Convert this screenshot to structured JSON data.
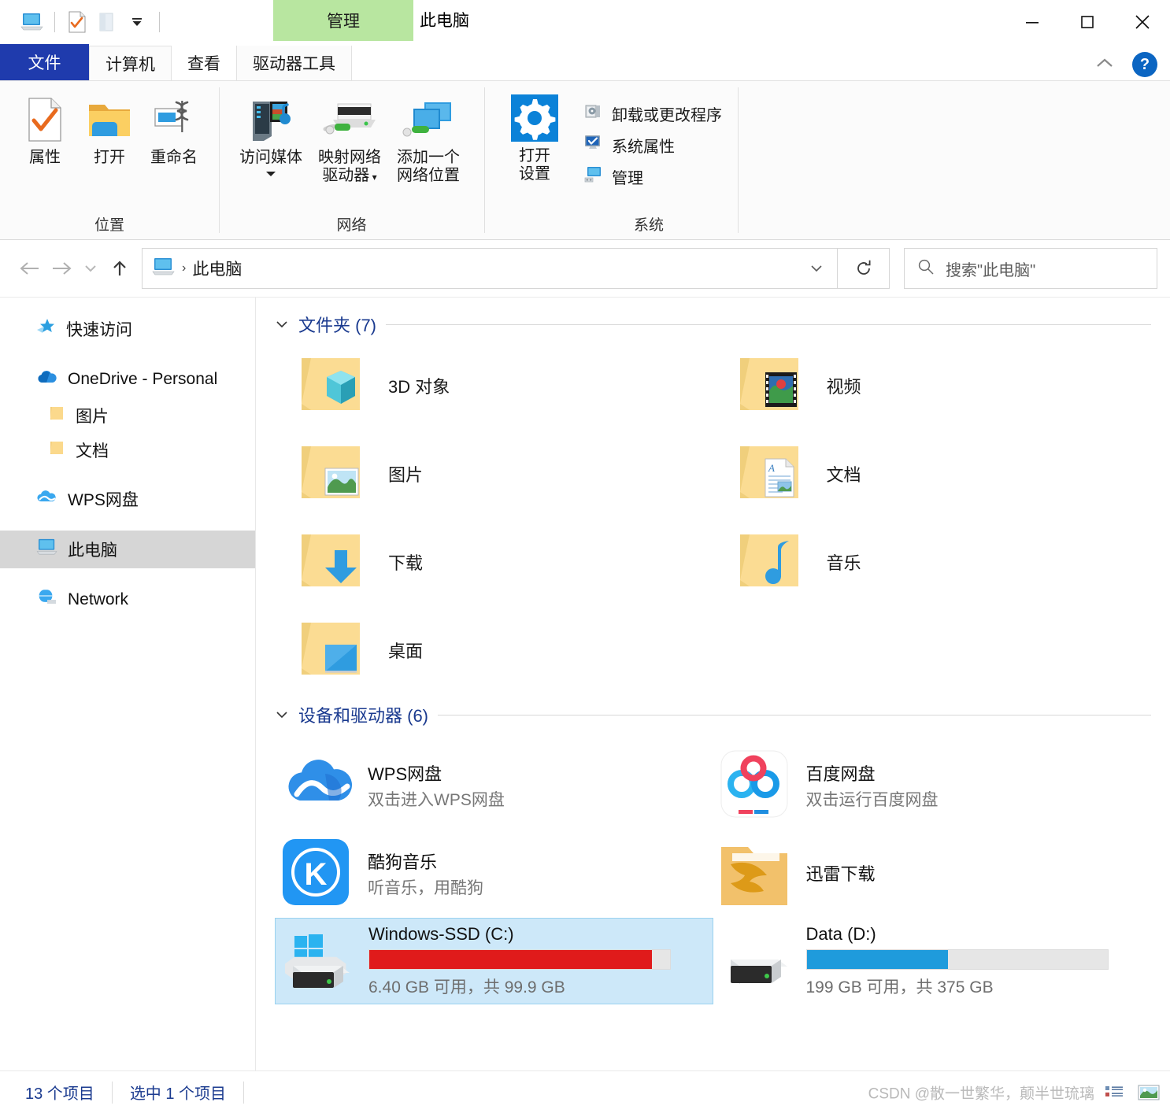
{
  "window": {
    "title": "此电脑",
    "contextual_tab_group": "管理",
    "quick_access_icons": [
      "this-pc-icon",
      "properties-check-icon",
      "open-folder-icon",
      "customize-dropdown-icon"
    ],
    "controls": {
      "minimize": "minimize-icon",
      "maximize": "maximize-icon",
      "close": "close-icon"
    }
  },
  "tabs": [
    {
      "label": "文件",
      "name": "tab-file"
    },
    {
      "label": "计算机",
      "name": "tab-computer"
    },
    {
      "label": "查看",
      "name": "tab-view"
    },
    {
      "label": "驱动器工具",
      "name": "tab-drive-tools"
    }
  ],
  "ribbon": {
    "collapse_icon": "chevron-up-icon",
    "help_label": "?",
    "groups": [
      {
        "label": "位置",
        "name": "ribbon-group-location",
        "buttons": [
          {
            "label": "属性",
            "name": "properties-button",
            "icon": "document-check-icon"
          },
          {
            "label": "打开",
            "name": "open-button",
            "icon": "folder-open-icon"
          },
          {
            "label": "重命名",
            "name": "rename-button",
            "icon": "rename-cursor-icon"
          }
        ]
      },
      {
        "label": "网络",
        "name": "ribbon-group-network",
        "buttons": [
          {
            "label": "访问媒体",
            "name": "access-media-button",
            "icon": "media-server-icon",
            "dropdown": true
          },
          {
            "label_line1": "映射网络",
            "label_line2": "驱动器",
            "name": "map-network-drive-button",
            "icon": "network-drive-icon",
            "dropdown": true
          },
          {
            "label_line1": "添加一个",
            "label_line2": "网络位置",
            "name": "add-network-location-button",
            "icon": "add-network-location-icon"
          }
        ]
      },
      {
        "label": "系统",
        "name": "ribbon-group-system",
        "big_button": {
          "label_line1": "打开",
          "label_line2": "设置",
          "name": "open-settings-button",
          "icon": "gear-icon"
        },
        "items": [
          {
            "label": "卸载或更改程序",
            "name": "uninstall-change-program-item",
            "icon": "uninstall-icon"
          },
          {
            "label": "系统属性",
            "name": "system-properties-item",
            "icon": "system-properties-icon"
          },
          {
            "label": "管理",
            "name": "manage-item",
            "icon": "manage-icon"
          }
        ]
      }
    ]
  },
  "addressbar": {
    "back": "back-arrow-icon",
    "forward": "forward-arrow-icon",
    "recent": "recent-locations-icon",
    "up": "up-arrow-icon",
    "breadcrumb_icon": "this-pc-icon",
    "breadcrumb": "此电脑",
    "breadcrumb_separator": "›",
    "dropdown": "chevron-down-icon",
    "refresh": "refresh-icon",
    "search_placeholder": "搜索\"此电脑\"",
    "search_value": "",
    "search_icon": "search-icon"
  },
  "sidebar": {
    "items": [
      {
        "label": "快速访问",
        "name": "sidebar-item-quick-access",
        "icon": "pin-star-icon",
        "indent": 0,
        "selected": false,
        "gap_after": true
      },
      {
        "label": "OneDrive - Personal",
        "name": "sidebar-item-onedrive",
        "icon": "onedrive-cloud-icon",
        "indent": 0,
        "selected": false,
        "gap_after": false
      },
      {
        "label": "图片",
        "name": "sidebar-item-onedrive-pictures",
        "icon": "folder-icon",
        "indent": 1,
        "selected": false,
        "gap_after": false
      },
      {
        "label": "文档",
        "name": "sidebar-item-onedrive-documents",
        "icon": "folder-icon",
        "indent": 1,
        "selected": false,
        "gap_after": true
      },
      {
        "label": "WPS网盘",
        "name": "sidebar-item-wps-cloud",
        "icon": "wps-cloud-icon",
        "indent": 0,
        "selected": false,
        "gap_after": true
      },
      {
        "label": "此电脑",
        "name": "sidebar-item-this-pc",
        "icon": "this-pc-icon",
        "indent": 0,
        "selected": true,
        "gap_after": true
      },
      {
        "label": "Network",
        "name": "sidebar-item-network",
        "icon": "network-globe-icon",
        "indent": 0,
        "selected": false,
        "gap_after": false
      }
    ]
  },
  "content": {
    "folders_section": {
      "title": "文件夹 (7)",
      "expanded": true,
      "items": [
        {
          "name": "3D 对象",
          "icon": "folder-3d-objects-icon"
        },
        {
          "name": "视频",
          "icon": "folder-videos-icon"
        },
        {
          "name": "图片",
          "icon": "folder-pictures-icon"
        },
        {
          "name": "文档",
          "icon": "folder-documents-icon"
        },
        {
          "name": "下载",
          "icon": "folder-downloads-icon"
        },
        {
          "name": "音乐",
          "icon": "folder-music-icon"
        },
        {
          "name": "桌面",
          "icon": "folder-desktop-icon"
        }
      ]
    },
    "devices_section": {
      "title": "设备和驱动器 (6)",
      "expanded": true,
      "apps": [
        {
          "title": "WPS网盘",
          "subtitle": "双击进入WPS网盘",
          "icon": "wps-cloud-icon"
        },
        {
          "title": "百度网盘",
          "subtitle": "双击运行百度网盘",
          "icon": "baidu-netdisk-icon"
        },
        {
          "title": "酷狗音乐",
          "subtitle": "听音乐，用酷狗",
          "icon": "kugou-music-icon"
        },
        {
          "title": "迅雷下载",
          "subtitle": "",
          "icon": "thunder-download-icon"
        }
      ],
      "drives": [
        {
          "title": "Windows-SSD (C:)",
          "capacity_text": "6.40 GB 可用，共 99.9 GB",
          "used_percent": 94,
          "bar_color": "#e01b1b",
          "selected": true,
          "icon": "windows-drive-icon"
        },
        {
          "title": "Data (D:)",
          "capacity_text": "199 GB 可用，共 375 GB",
          "used_percent": 47,
          "bar_color": "#1f9bdc",
          "selected": false,
          "icon": "hard-drive-icon"
        }
      ]
    }
  },
  "statusbar": {
    "item_count": "13 个项目",
    "selection_count": "选中 1 个项目",
    "watermark": "CSDN @散一世繁华，颠半世琉璃",
    "view_buttons": [
      {
        "name": "details-view-button",
        "icon": "details-view-icon"
      },
      {
        "name": "large-icons-view-button",
        "icon": "large-icons-view-icon"
      }
    ]
  },
  "colors": {
    "file_tab": "#1f3bad",
    "contextual_tab": "#b8e6a0",
    "section_title": "#1a3a8f",
    "selection": "#cde8f9",
    "accent": "#0b65c2"
  }
}
